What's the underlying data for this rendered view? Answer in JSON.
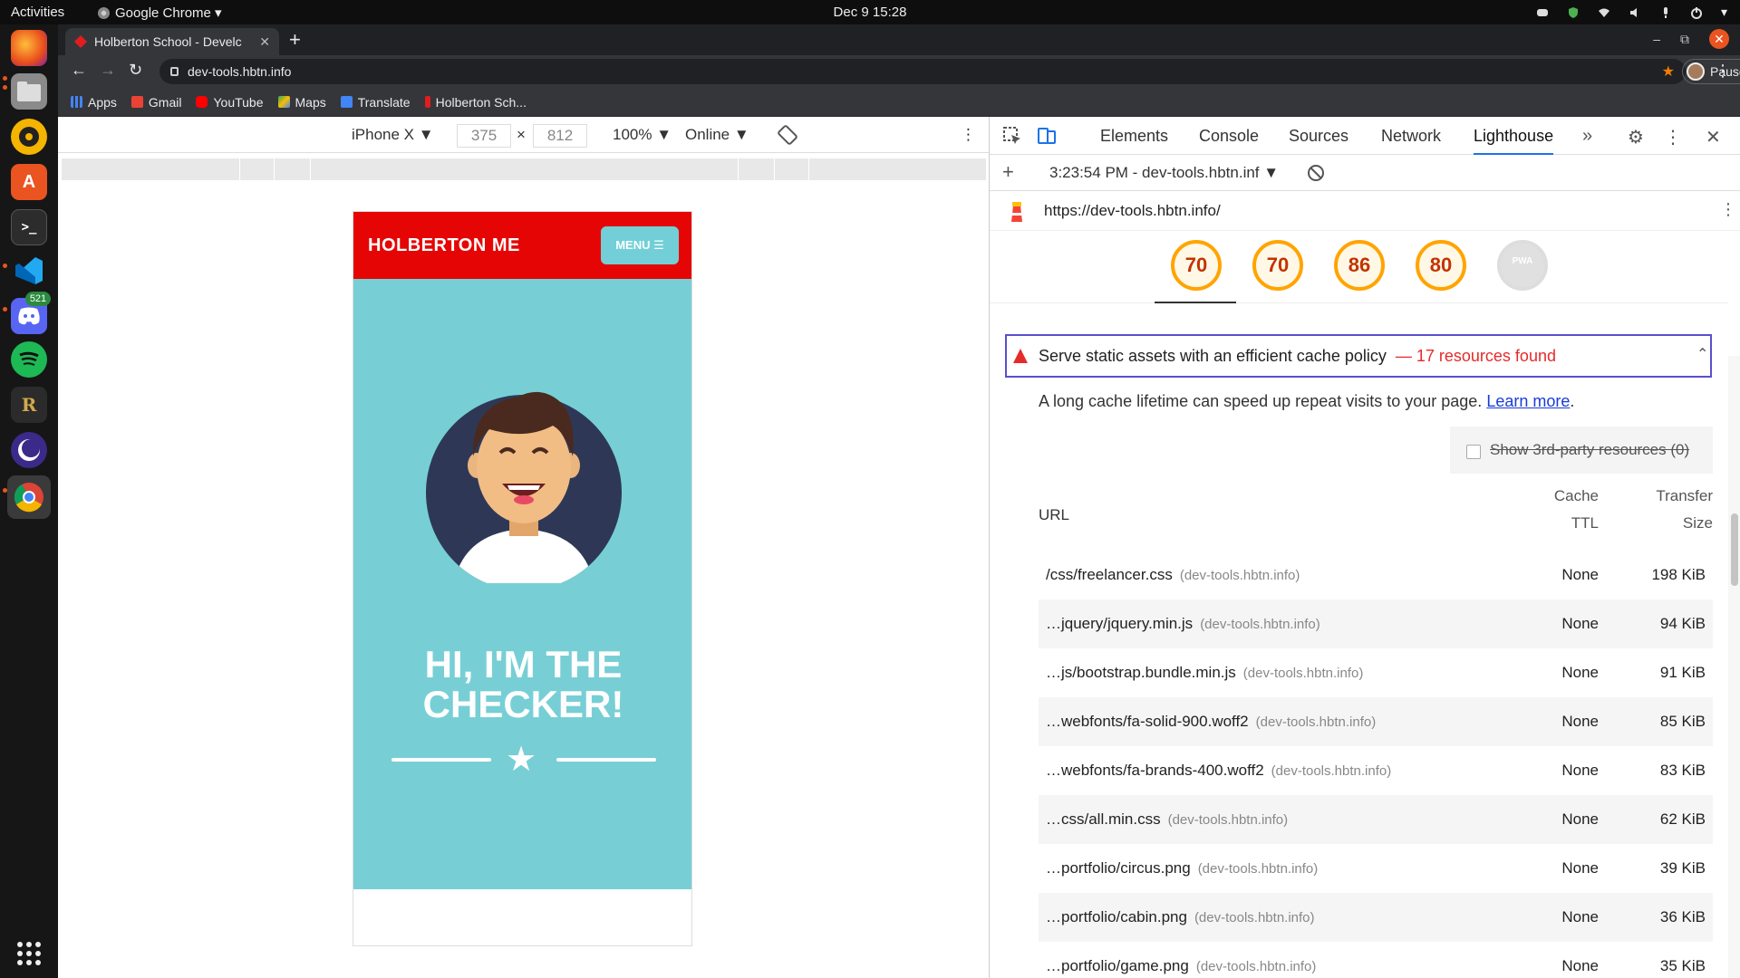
{
  "topbar": {
    "activities": "Activities",
    "app_menu": "Google Chrome ▾",
    "clock": "Dec 9  15:28"
  },
  "dock": {
    "badge": "521"
  },
  "browser": {
    "tab_title": "Holberton School - Develc",
    "tab_close": "✕",
    "url": "dev-tools.hbtn.info",
    "profile_label": "Paused",
    "bookmarks": [
      "Apps",
      "Gmail",
      "YouTube",
      "Maps",
      "Translate",
      "Holberton Sch..."
    ]
  },
  "device_toolbar": {
    "device": "iPhone X",
    "width": "375",
    "height": "812",
    "zoom": "100%",
    "network": "Online"
  },
  "phone_page": {
    "brand": "HOLBERTON ME",
    "menu": "MENU ☰",
    "hero_title_line1": "HI, I'M THE",
    "hero_title_line2": "CHECKER!"
  },
  "devtools": {
    "tabs": [
      "Elements",
      "Console",
      "Sources",
      "Network",
      "Lighthouse"
    ],
    "report_select": "3:23:54 PM - dev-tools.hbtn.inf",
    "report_url": "https://dev-tools.hbtn.info/",
    "scores": [
      "70",
      "70",
      "86",
      "80"
    ],
    "pwa_label": "PWA",
    "audit": {
      "title": "Serve static assets with an efficient cache policy",
      "found": "— 17 resources found",
      "description": "A long cache lifetime can speed up repeat visits to your page.",
      "learn_more": "Learn more",
      "third_party": "Show 3rd-party resources (0)",
      "col_url": "URL",
      "col_cache_1": "Cache",
      "col_cache_2": "TTL",
      "col_size_1": "Transfer",
      "col_size_2": "Size",
      "rows": [
        {
          "path": "/css/freelancer.css",
          "host": "(dev-tools.hbtn.info)",
          "ttl": "None",
          "size": "198 KiB"
        },
        {
          "path": "…jquery/jquery.min.js",
          "host": "(dev-tools.hbtn.info)",
          "ttl": "None",
          "size": "94 KiB"
        },
        {
          "path": "…js/bootstrap.bundle.min.js",
          "host": "(dev-tools.hbtn.info)",
          "ttl": "None",
          "size": "91 KiB"
        },
        {
          "path": "…webfonts/fa-solid-900.woff2",
          "host": "(dev-tools.hbtn.info)",
          "ttl": "None",
          "size": "85 KiB"
        },
        {
          "path": "…webfonts/fa-brands-400.woff2",
          "host": "(dev-tools.hbtn.info)",
          "ttl": "None",
          "size": "83 KiB"
        },
        {
          "path": "…css/all.min.css",
          "host": "(dev-tools.hbtn.info)",
          "ttl": "None",
          "size": "62 KiB"
        },
        {
          "path": "…portfolio/circus.png",
          "host": "(dev-tools.hbtn.info)",
          "ttl": "None",
          "size": "39 KiB"
        },
        {
          "path": "…portfolio/cabin.png",
          "host": "(dev-tools.hbtn.info)",
          "ttl": "None",
          "size": "36 KiB"
        },
        {
          "path": "…portfolio/game.png",
          "host": "(dev-tools.hbtn.info)",
          "ttl": "None",
          "size": "35 KiB"
        }
      ]
    }
  }
}
